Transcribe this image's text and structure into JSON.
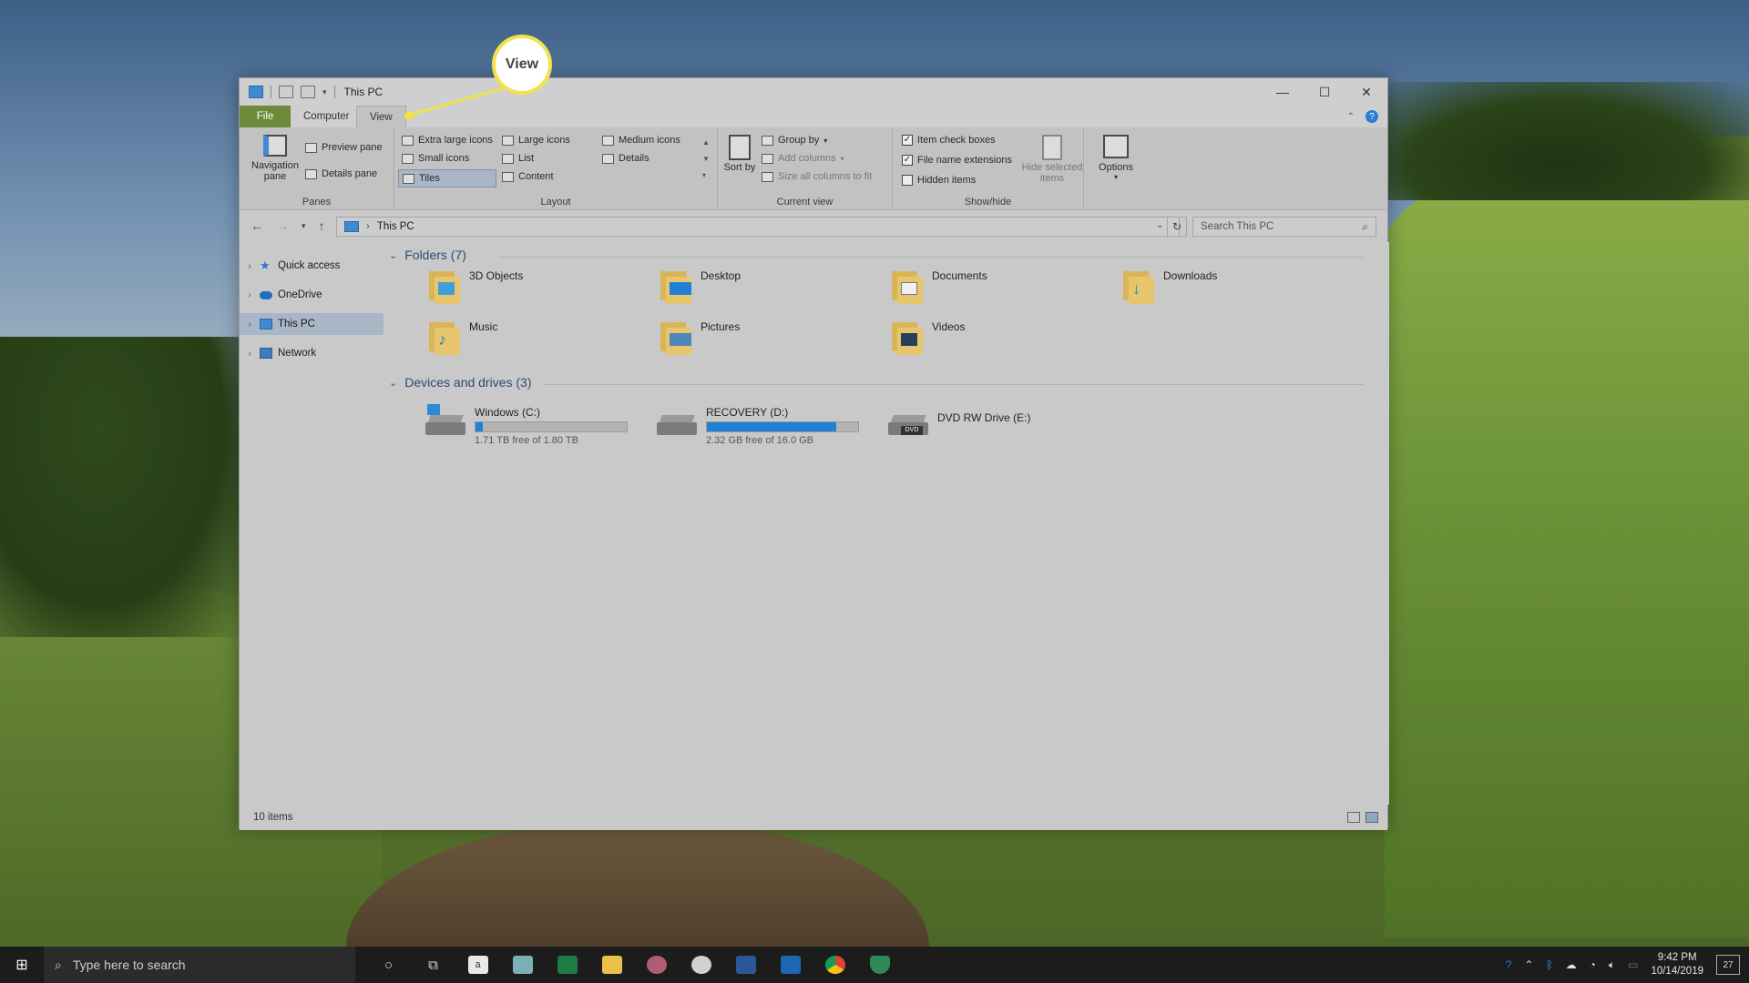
{
  "window": {
    "title": "This PC",
    "controls": {
      "minimize": "—",
      "maximize": "☐",
      "close": "✕"
    }
  },
  "callout": {
    "label": "View"
  },
  "tabs": [
    {
      "label": "File"
    },
    {
      "label": "Computer"
    },
    {
      "label": "View"
    }
  ],
  "ribbon": {
    "panes": {
      "group_label": "Panes",
      "navigation_pane": "Navigation pane",
      "preview_pane": "Preview pane",
      "details_pane": "Details pane"
    },
    "layout": {
      "group_label": "Layout",
      "options": [
        "Extra large icons",
        "Large icons",
        "Medium icons",
        "Small icons",
        "List",
        "Details",
        "Tiles",
        "Content"
      ],
      "selected": "Tiles"
    },
    "current_view": {
      "group_label": "Current view",
      "sort_by": "Sort by",
      "group_by": "Group by",
      "add_columns": "Add columns",
      "size_columns": "Size all columns to fit"
    },
    "show_hide": {
      "group_label": "Show/hide",
      "item_check_boxes": {
        "label": "Item check boxes",
        "checked": true
      },
      "file_name_extensions": {
        "label": "File name extensions",
        "checked": true
      },
      "hidden_items": {
        "label": "Hidden items",
        "checked": false
      },
      "hide_selected": "Hide selected items"
    },
    "options": "Options"
  },
  "address": {
    "path": "This PC",
    "search_placeholder": "Search This PC"
  },
  "nav_pane": {
    "items": [
      {
        "label": "Quick access",
        "selected": false
      },
      {
        "label": "OneDrive",
        "selected": false
      },
      {
        "label": "This PC",
        "selected": true
      },
      {
        "label": "Network",
        "selected": false
      }
    ]
  },
  "content": {
    "folders_header": "Folders (7)",
    "folders": [
      {
        "label": "3D Objects"
      },
      {
        "label": "Desktop"
      },
      {
        "label": "Documents"
      },
      {
        "label": "Downloads"
      },
      {
        "label": "Music"
      },
      {
        "label": "Pictures"
      },
      {
        "label": "Videos"
      }
    ],
    "devices_header": "Devices and drives (3)",
    "drives": [
      {
        "label": "Windows (C:)",
        "free": "1.71 TB free of 1.80 TB",
        "used_fraction": 0.05
      },
      {
        "label": "RECOVERY (D:)",
        "free": "2.32 GB free of 16.0 GB",
        "used_fraction": 0.855
      },
      {
        "label": "DVD RW Drive (E:)"
      }
    ]
  },
  "status": {
    "items": "10 items"
  },
  "taskbar": {
    "search_placeholder": "Type here to search",
    "time": "9:42 PM",
    "date": "10/14/2019",
    "notifications": "27"
  },
  "colors": {
    "accent": "#1f80d6",
    "callout": "#f2e24a",
    "file_tab": "#6d8a3a"
  }
}
